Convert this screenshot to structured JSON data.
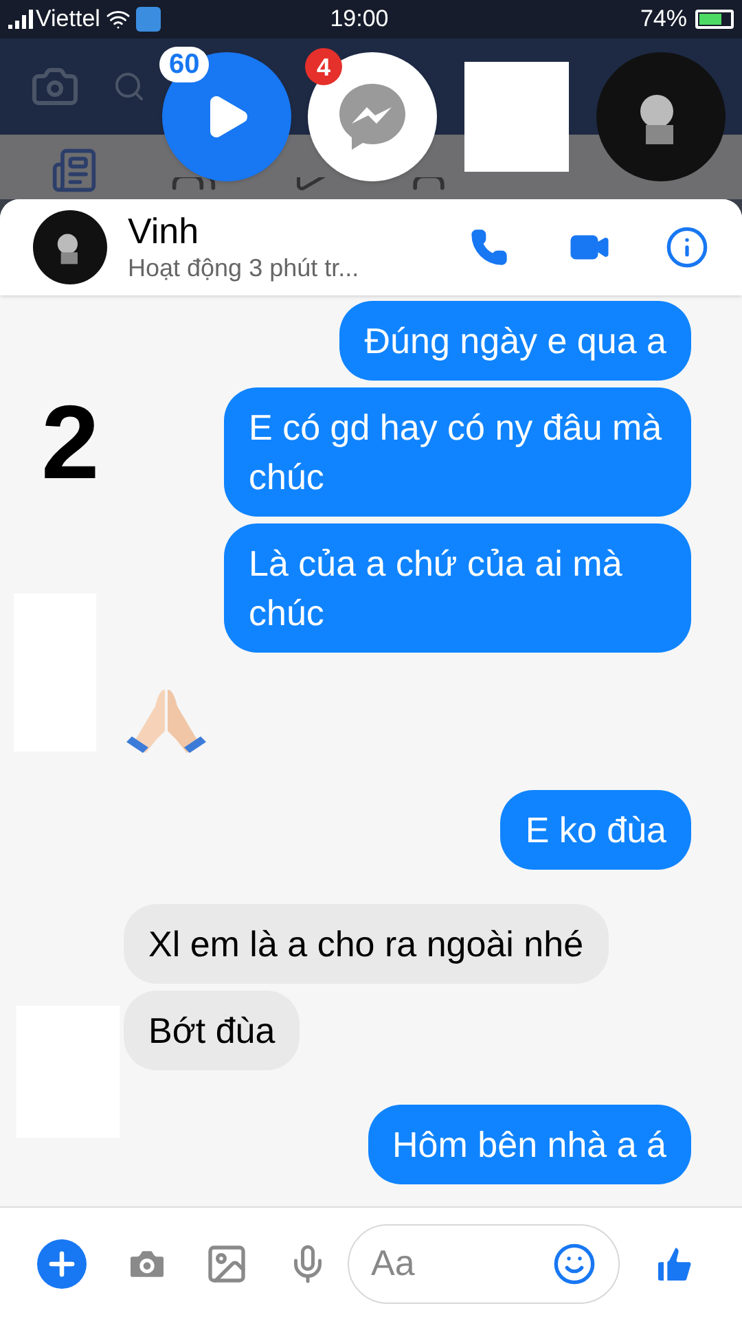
{
  "status_bar": {
    "carrier": "Viettel",
    "time": "19:00",
    "battery": "74%"
  },
  "chat_heads": [
    {
      "kind": "video",
      "badge": "60"
    },
    {
      "kind": "messenger",
      "badge": "4"
    },
    {
      "kind": "hidden"
    },
    {
      "kind": "avatar"
    }
  ],
  "header": {
    "name": "Vinh",
    "status": "Hoạt động 3 phút tr..."
  },
  "annotation": "2",
  "messages": [
    {
      "kind": "sent",
      "text": "Đúng ngày e qua a"
    },
    {
      "kind": "sent",
      "text": "E có gd hay có ny đâu mà chúc"
    },
    {
      "kind": "sent",
      "text": "Là của a chứ của ai mà chúc"
    },
    {
      "kind": "emoji"
    },
    {
      "kind": "sent",
      "text": "E ko đùa"
    },
    {
      "kind": "received",
      "text": "Xl em là a cho ra ngoài nhé"
    },
    {
      "kind": "received",
      "text": "Bớt đùa"
    },
    {
      "kind": "sent",
      "text": "Hôm bên nhà a á"
    }
  ],
  "composer": {
    "placeholder": "Aa"
  }
}
